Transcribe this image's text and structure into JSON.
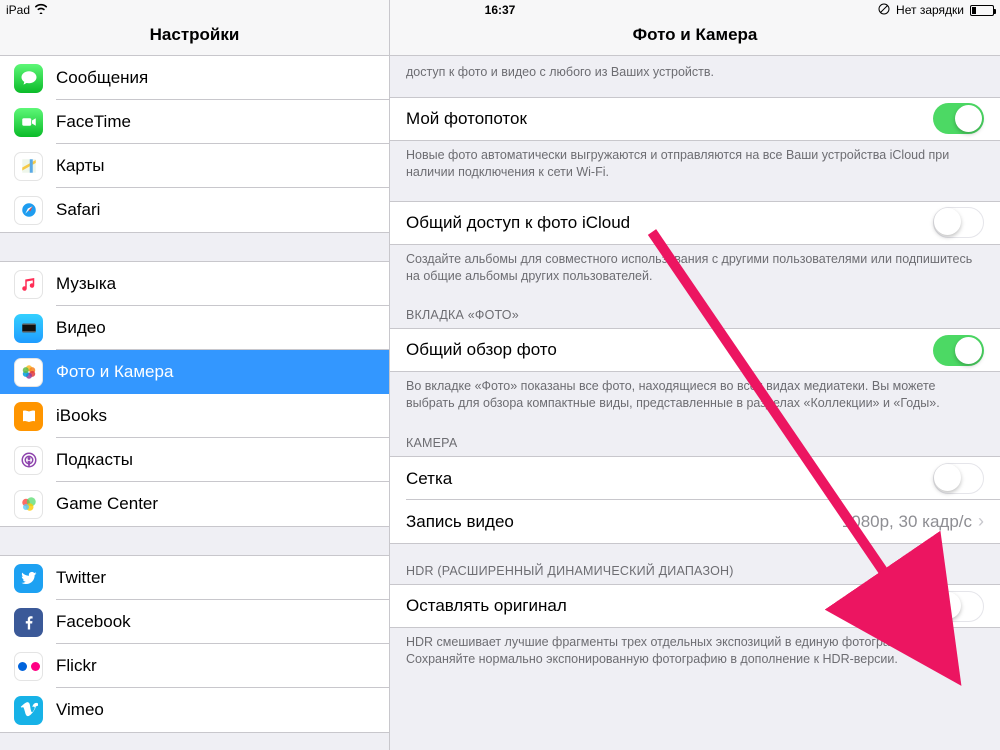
{
  "statusbar": {
    "device": "iPad",
    "time": "16:37",
    "charging_text": "Нет зарядки"
  },
  "sidebar": {
    "title": "Настройки",
    "groups": [
      {
        "items": [
          {
            "key": "messages",
            "label": "Сообщения",
            "icon": "messages-icon"
          },
          {
            "key": "facetime",
            "label": "FaceTime",
            "icon": "facetime-icon"
          },
          {
            "key": "maps",
            "label": "Карты",
            "icon": "maps-icon"
          },
          {
            "key": "safari",
            "label": "Safari",
            "icon": "safari-icon"
          }
        ]
      },
      {
        "items": [
          {
            "key": "music",
            "label": "Музыка",
            "icon": "music-icon"
          },
          {
            "key": "video",
            "label": "Видео",
            "icon": "video-icon"
          },
          {
            "key": "photos",
            "label": "Фото и Камера",
            "icon": "photos-icon",
            "selected": true
          },
          {
            "key": "ibooks",
            "label": "iBooks",
            "icon": "ibooks-icon"
          },
          {
            "key": "podcasts",
            "label": "Подкасты",
            "icon": "podcasts-icon"
          },
          {
            "key": "gamecenter",
            "label": "Game Center",
            "icon": "gamecenter-icon"
          }
        ]
      },
      {
        "items": [
          {
            "key": "twitter",
            "label": "Twitter",
            "icon": "twitter-icon"
          },
          {
            "key": "facebook",
            "label": "Facebook",
            "icon": "facebook-icon"
          },
          {
            "key": "flickr",
            "label": "Flickr",
            "icon": "flickr-icon"
          },
          {
            "key": "vimeo",
            "label": "Vimeo",
            "icon": "vimeo-icon"
          }
        ]
      }
    ]
  },
  "detail": {
    "title": "Фото и Камера",
    "partial_footer_top": "доступ к фото и видео с любого из Ваших устройств.",
    "sections": {
      "photostream": {
        "label": "Мой фотопоток",
        "on": true,
        "footer": "Новые фото автоматически выгружаются и отправляются на все Ваши устройства iCloud при наличии подключения к сети Wi-Fi."
      },
      "sharing": {
        "label": "Общий доступ к фото iCloud",
        "on": false,
        "footer": "Создайте альбомы для совместного использования с другими пользователями или подпишитесь на общие альбомы других пользователей."
      },
      "tab": {
        "header": "ВКЛАДКА «ФОТО»",
        "label": "Общий обзор фото",
        "on": true,
        "footer": "Во вкладке «Фото» показаны все фото, находящиеся во всех видах медиатеки. Вы можете выбрать для обзора компактные виды, представленные в разделах «Коллекции» и «Годы»."
      },
      "camera": {
        "header": "КАМЕРА",
        "grid_label": "Сетка",
        "grid_on": false,
        "record_label": "Запись видео",
        "record_value": "1080p, 30 кадр/с"
      },
      "hdr": {
        "header": "HDR (РАСШИРЕННЫЙ ДИНАМИЧЕСКИЙ ДИАПАЗОН)",
        "label": "Оставлять оригинал",
        "on": false,
        "footer": "HDR смешивает лучшие фрагменты трех отдельных экспозиций в единую фотографию. Сохраняйте нормально экспонированную фотографию в дополнение к HDR-версии."
      }
    }
  }
}
